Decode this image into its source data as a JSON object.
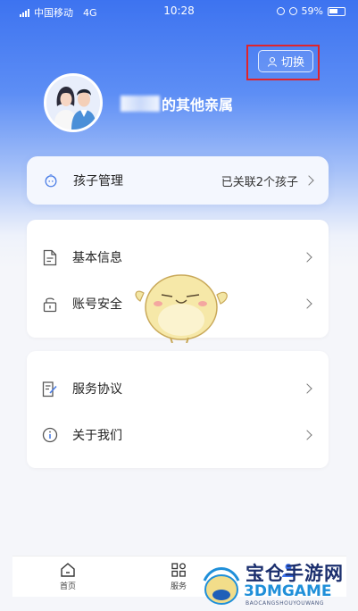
{
  "status_bar": {
    "carrier": "中国移动",
    "network": "4G",
    "time": "10:28",
    "battery": "59%"
  },
  "header": {
    "switch_label": "切换",
    "family_title": "的其他亲属"
  },
  "kids": {
    "label": "孩子管理",
    "value": "已关联2个孩子"
  },
  "menu_group_1": [
    {
      "label": "基本信息",
      "icon": "document-icon"
    },
    {
      "label": "账号安全",
      "icon": "lock-icon"
    }
  ],
  "menu_group_2": [
    {
      "label": "服务协议",
      "icon": "agreement-icon"
    },
    {
      "label": "关于我们",
      "icon": "info-icon"
    }
  ],
  "bottom_nav": [
    {
      "label": "首页",
      "icon": "home-icon"
    },
    {
      "label": "服务",
      "icon": "grid-icon"
    },
    {
      "label": "",
      "icon": "profile-icon"
    }
  ],
  "watermark": {
    "cn": "宝仓手游网",
    "en": "3DMGAME",
    "sub": "BAOCANGSHOUYOUWANG"
  },
  "colors": {
    "accent": "#3d73f0",
    "highlight_box": "#e0242b"
  }
}
